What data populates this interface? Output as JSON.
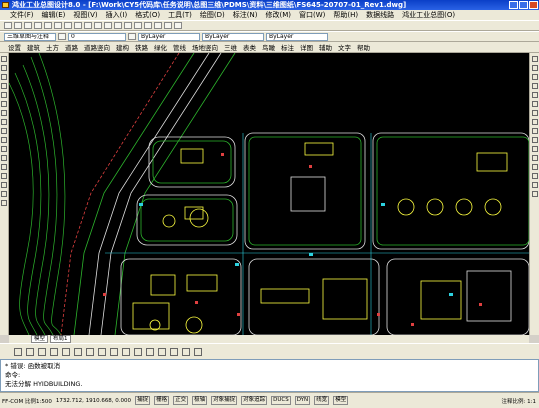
{
  "window": {
    "title": "鸿业工业总图设计8.0 - [F:\\Work\\CY5代码库\\任务说明\\总图三维\\PDMS\\资料\\三维图纸\\FS645-20707-01_Rev1.dwg]"
  },
  "menu": [
    "文件(F)",
    "编辑(E)",
    "视图(V)",
    "插入(I)",
    "格式(O)",
    "工具(T)",
    "绘图(D)",
    "标注(N)",
    "修改(M)",
    "窗口(W)",
    "帮助(H)",
    "数据线路",
    "鸿业工业总图(O)"
  ],
  "toolbar": {
    "workspace": "三维草图与注释",
    "layer_name": "0",
    "color": "ByLayer",
    "linetype": "ByLayer",
    "lineweight": "ByLayer",
    "plot_style": "FF-COM"
  },
  "cad_menu": [
    "设置",
    "建筑",
    "土方",
    "道路",
    "道路竖向",
    "建构",
    "铁路",
    "绿化",
    "管线",
    "场地竖向",
    "三维",
    "表类",
    "鸟瞰",
    "标注",
    "详图",
    "辅助",
    "文字",
    "帮助"
  ],
  "model_tabs": [
    "模型",
    "布局1"
  ],
  "command": {
    "lines": [
      "* 错误: 函数被取消",
      "命令:",
      "无法分解 HYIDBUILDING."
    ]
  },
  "status": {
    "scale": "FF-COM 比例1:500",
    "coords": "1732.712, 1910.668, 0.000",
    "toggles": [
      "捕捉",
      "栅格",
      "正交",
      "极轴",
      "对象捕捉",
      "对象追踪",
      "DUCS",
      "DYN",
      "线宽",
      "模型"
    ],
    "annot_scale": "注释比例: 1:1"
  }
}
